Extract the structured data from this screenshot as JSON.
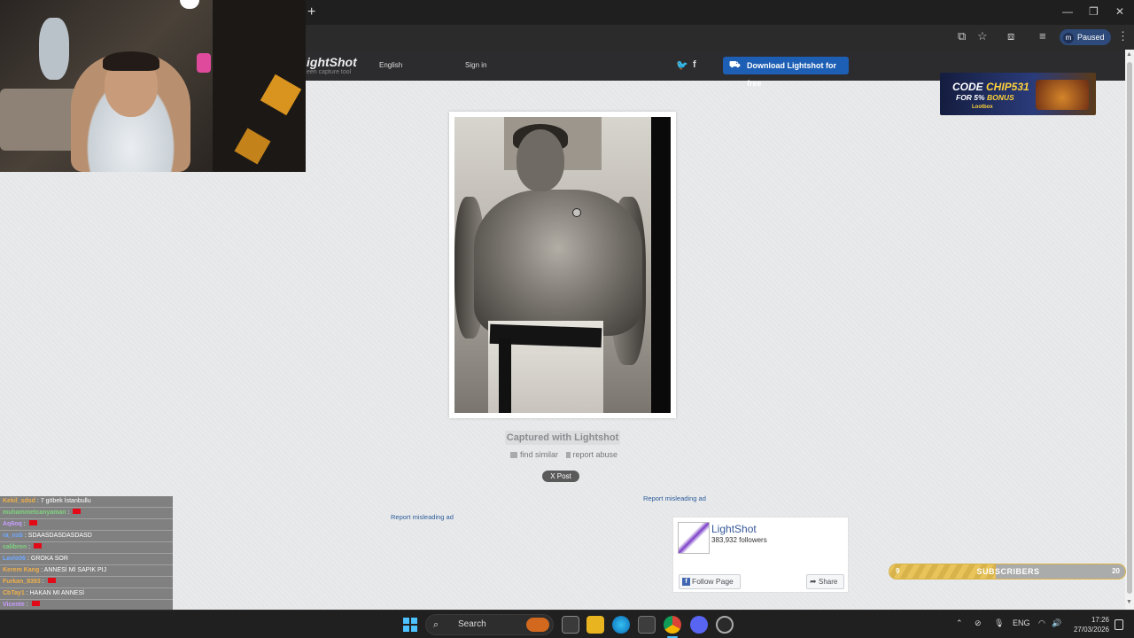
{
  "browser": {
    "new_tab": "+",
    "minimize": "—",
    "maximize": "❐",
    "close": "✕",
    "profile_initial": "m",
    "profile_status": "Paused"
  },
  "lightshot": {
    "logo": "ightShot",
    "tagline": "een capture tool",
    "language": "English",
    "sign_in": "Sign in",
    "twitter": "🐦",
    "facebook": "f",
    "download_label": "Download Lightshot for free",
    "captured_label": "Captured with Lightshot",
    "find_similar": "find similar",
    "report_abuse": "report abuse",
    "post_label": "X Post",
    "report_misleading_1": "Report misleading ad",
    "report_misleading_2": "Report misleading ad"
  },
  "ad": {
    "code_word": "CODE",
    "code_value": "CHIP531",
    "bonus_prefix": "FOR 5%",
    "bonus_word": "BONUS",
    "brand": "Lootbox"
  },
  "facebook_widget": {
    "page_name": "LightShot",
    "followers": "383,932 followers",
    "follow_label": "Follow Page",
    "share_label": "Share"
  },
  "chat": [
    {
      "user": "Kekil_sdsd",
      "message": " : 7 göbek İstanbullu",
      "flag": false,
      "color": "#f0b04a"
    },
    {
      "user": "muhammetcanyaman",
      "message": " : ",
      "flag": true,
      "color": "#7fd37f"
    },
    {
      "user": "Aq6oq",
      "message": " : ",
      "flag": true,
      "color": "#c79cff"
    },
    {
      "user": "ra_nsb",
      "message": " : SDAASDASDASDASD",
      "flag": false,
      "color": "#6fa8ff"
    },
    {
      "user": "calibron",
      "message": " : ",
      "flag": true,
      "color": "#7fd37f"
    },
    {
      "user": "Lavlo06",
      "message": " : GROKA SOR",
      "flag": false,
      "color": "#6fa8ff"
    },
    {
      "user": "Kerem Kang",
      "message": " : ANNESİ Mİ SAPIK PIJ",
      "flag": false,
      "color": "#f0b04a"
    },
    {
      "user": "Furkan_8393",
      "message": " : ",
      "flag": true,
      "color": "#f0b04a"
    },
    {
      "user": "CbTay1",
      "message": " : HAKAN MI ANNESİ",
      "flag": false,
      "color": "#f0b04a"
    },
    {
      "user": "Vicente",
      "message": " : ",
      "flag": true,
      "color": "#c79cff"
    },
    {
      "user": "muhammetcanyaman",
      "message": " : ",
      "flag": true,
      "color": "#ffffff"
    }
  ],
  "subscribers": {
    "current": "9",
    "label": "SUBSCRIBERS",
    "goal": "20",
    "progress": 0.45
  },
  "taskbar": {
    "search_label": "Search",
    "language": "ENG",
    "time": "17:26",
    "date": "27/03/2026"
  },
  "icons": {
    "search": "search-icon",
    "windows": "windows-start-icon",
    "notifications": "notification-icon"
  }
}
